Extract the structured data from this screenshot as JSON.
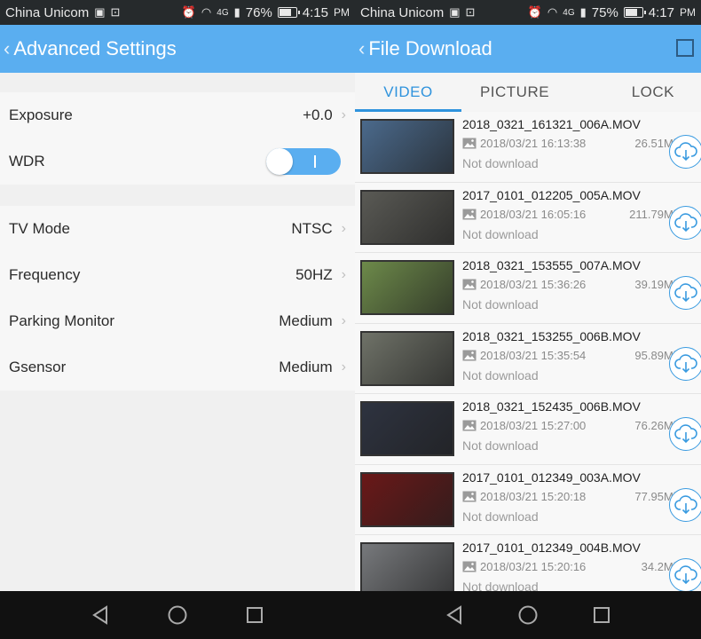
{
  "left": {
    "status": {
      "carrier": "China Unicom",
      "battery_pct": "76%",
      "battery_level": 0.76,
      "time": "4:15",
      "ampm": "PM",
      "network": "4G"
    },
    "title": "Advanced Settings",
    "group1": [
      {
        "label": "Exposure",
        "value": "+0.0"
      },
      {
        "label": "WDR",
        "toggle": true
      }
    ],
    "group2": [
      {
        "label": "TV Mode",
        "value": "NTSC"
      },
      {
        "label": "Frequency",
        "value": "50HZ"
      },
      {
        "label": "Parking Monitor",
        "value": "Medium"
      },
      {
        "label": "Gsensor",
        "value": "Medium"
      }
    ]
  },
  "right": {
    "status": {
      "carrier": "China Unicom",
      "battery_pct": "75%",
      "battery_level": 0.75,
      "time": "4:17",
      "ampm": "PM",
      "network": "4G"
    },
    "title": "File Download",
    "tabs": [
      "VIDEO",
      "PICTURE",
      "LOCK"
    ],
    "files": [
      {
        "name": "2018_0321_161321_006A.MOV",
        "date": "2018/03/21 16:13:38",
        "size": "26.51Mb",
        "state": "Not download",
        "thumb_color": "#4b6a8c"
      },
      {
        "name": "2017_0101_012205_005A.MOV",
        "date": "2018/03/21 16:05:16",
        "size": "211.79Mb",
        "state": "Not download",
        "thumb_color": "#5a5a55"
      },
      {
        "name": "2018_0321_153555_007A.MOV",
        "date": "2018/03/21 15:36:26",
        "size": "39.19Mb",
        "state": "Not download",
        "thumb_color": "#6d8a4a"
      },
      {
        "name": "2018_0321_153255_006B.MOV",
        "date": "2018/03/21 15:35:54",
        "size": "95.89Mb",
        "state": "Not download",
        "thumb_color": "#6f7268"
      },
      {
        "name": "2018_0321_152435_006B.MOV",
        "date": "2018/03/21 15:27:00",
        "size": "76.26Mb",
        "state": "Not download",
        "thumb_color": "#2e3340"
      },
      {
        "name": "2017_0101_012349_003A.MOV",
        "date": "2018/03/21 15:20:18",
        "size": "77.95Mb",
        "state": "Not download",
        "thumb_color": "#6a1818"
      },
      {
        "name": "2017_0101_012349_004B.MOV",
        "date": "2018/03/21 15:20:16",
        "size": "34.2Mb",
        "state": "Not download",
        "thumb_color": "#77797c"
      }
    ]
  },
  "colors": {
    "accent": "#5aaef0",
    "tab_active": "#2f93dd"
  }
}
